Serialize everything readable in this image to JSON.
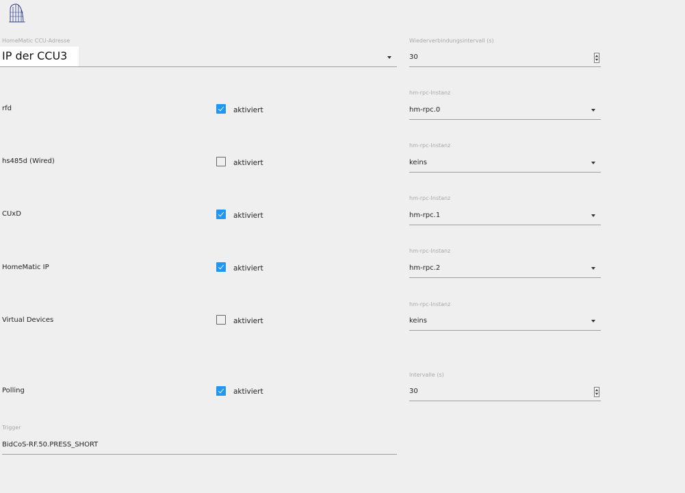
{
  "logo": {
    "icon": "homematic-logo-icon"
  },
  "ccu_address": {
    "label": "HomeMatic CCU-Adresse",
    "value": "IP der CCU3"
  },
  "reconnect": {
    "label": "Wiederverbindungsintervall (s)",
    "value": "30"
  },
  "rows": [
    {
      "name": "rfd",
      "checked": true,
      "check_label": "aktiviert",
      "instance_label": "hm-rpc-Instanz",
      "instance_value": "hm-rpc.0"
    },
    {
      "name": "hs485d (Wired)",
      "checked": false,
      "check_label": "aktiviert",
      "instance_label": "hm-rpc-Instanz",
      "instance_value": "keins"
    },
    {
      "name": "CUxD",
      "checked": true,
      "check_label": "aktiviert",
      "instance_label": "hm-rpc-Instanz",
      "instance_value": "hm-rpc.1"
    },
    {
      "name": "HomeMatic IP",
      "checked": true,
      "check_label": "aktiviert",
      "instance_label": "hm-rpc-Instanz",
      "instance_value": "hm-rpc.2"
    },
    {
      "name": "Virtual Devices",
      "checked": false,
      "check_label": "aktiviert",
      "instance_label": "hm-rpc-Instanz",
      "instance_value": "keins"
    }
  ],
  "polling": {
    "name": "Polling",
    "checked": true,
    "check_label": "aktiviert",
    "interval_label": "Intervalle (s)",
    "interval_value": "30"
  },
  "trigger": {
    "label": "Trigger",
    "value": "BidCoS-RF.50.PRESS_SHORT"
  },
  "colors": {
    "background": "#efefef",
    "checkbox_on": "#2196f3",
    "label_muted": "#a8a8a8"
  }
}
